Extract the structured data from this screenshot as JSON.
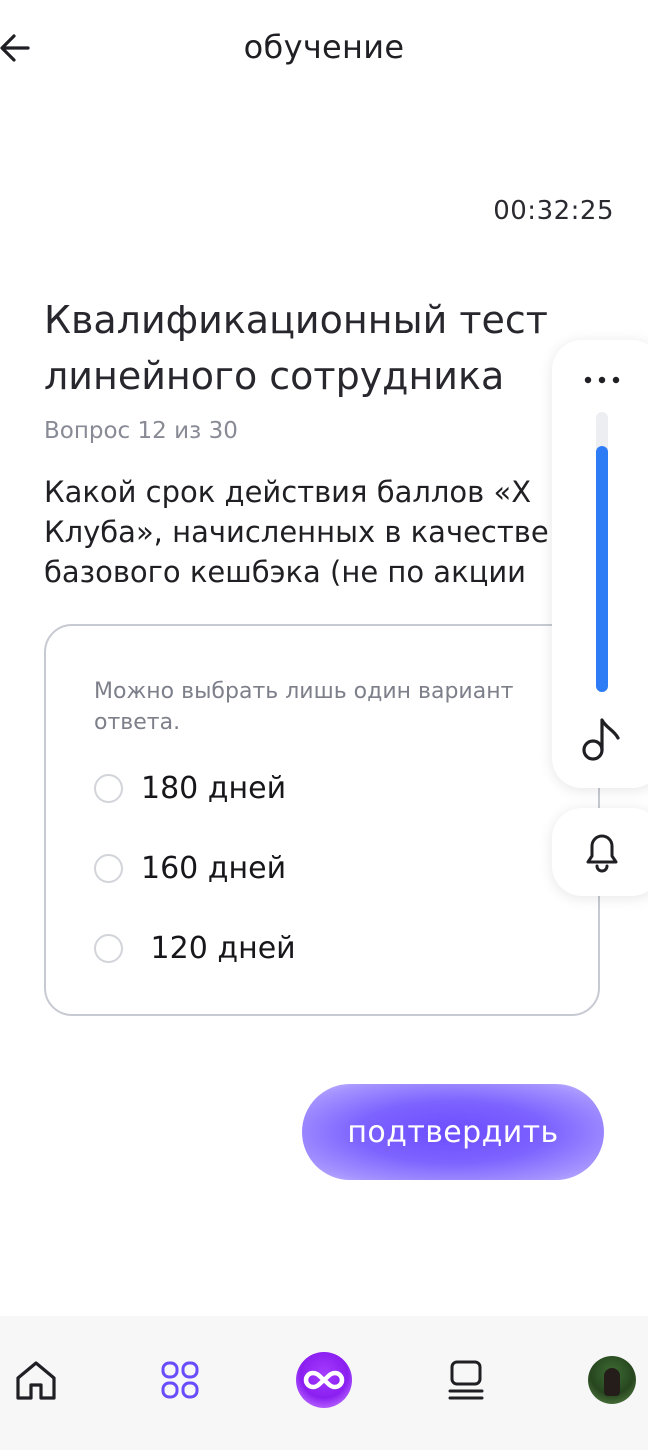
{
  "header": {
    "title": "обучение"
  },
  "timer": "00:32:25",
  "test": {
    "title_lines": [
      "Квалификационный тест",
      "линейного сотрудника"
    ],
    "counter": "Вопрос 12 из 30",
    "question_lines": [
      "Какой срок действия баллов «Х",
      "Клуба», начисленных в качестве",
      "базового кешбэка (не по акции"
    ]
  },
  "answers": {
    "hint": "Можно выбрать лишь один вариант ответа.",
    "options": [
      {
        "label": "180 дней",
        "selected": false
      },
      {
        "label": "160 дней",
        "selected": false
      },
      {
        "label": " 120 дней",
        "selected": false
      }
    ]
  },
  "confirm_label": "подтвердить",
  "player": {
    "volume_percent": 88,
    "accent_color": "#2d7cf6"
  },
  "colors": {
    "primary": "#7b61ff",
    "text": "#1f1f24",
    "muted": "#888b95"
  },
  "nav": {
    "items": [
      {
        "name": "home-icon"
      },
      {
        "name": "apps-grid-icon"
      },
      {
        "name": "infinity-logo-icon"
      },
      {
        "name": "stack-icon"
      },
      {
        "name": "profile-avatar"
      }
    ]
  }
}
